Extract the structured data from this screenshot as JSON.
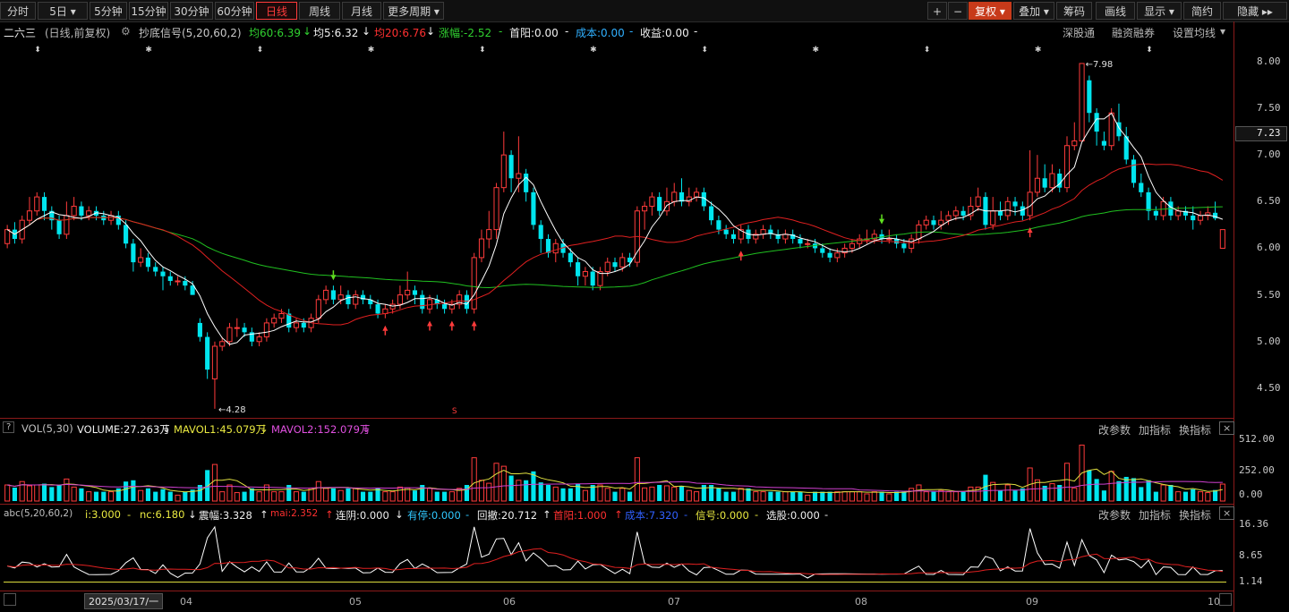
{
  "toolbar": {
    "left": [
      "分时",
      "5日",
      "5分钟",
      "15分钟",
      "30分钟",
      "60分钟",
      "日线",
      "周线",
      "月线",
      "更多周期"
    ],
    "right": [
      "+",
      "−",
      "复权",
      "叠加",
      "筹码",
      "画线",
      "显示",
      "简约",
      "隐藏"
    ],
    "dropdown_glyph": "▾",
    "hide_glyph": "▸▸"
  },
  "info": {
    "name": "二六三",
    "mode": "(日线,前复权)",
    "indicator": "抄底信号(5,20,60,2)",
    "ma60": "均60:6.39",
    "ma60_arrow": "↓",
    "ma5": "均5:6.32",
    "ma5_arrow": "↓",
    "ma20": "均20:6.76",
    "ma20_arrow": "↓",
    "zhangfu": "涨幅:-2.52",
    "shouyang": "首阳:0.00",
    "dash": "-",
    "chengben": "成本:0.00",
    "shouyi": "收益:0.00",
    "links": [
      "深股通",
      "融资融券",
      "设置均线"
    ]
  },
  "price_axis": [
    "8.00",
    "7.50",
    "7.23",
    "7.00",
    "6.50",
    "6.00",
    "5.50",
    "5.00",
    "4.50"
  ],
  "price_axis_current": "7.23",
  "annotations": {
    "high": "←7.98",
    "low": "←4.28",
    "s_mark": "S"
  },
  "vol": {
    "help": "?",
    "label": "VOL(5,30)",
    "volume": "VOLUME:27.263万",
    "volume_arrow": "↓",
    "mavol1": "MAVOL1:45.079万",
    "mavol1_arrow": "↓",
    "mavol2": "MAVOL2:152.079万",
    "mavol2_arrow": "↓",
    "buttons": [
      "改参数",
      "加指标",
      "换指标"
    ],
    "close": "×",
    "axis": [
      "512.00",
      "252.00",
      "0.00"
    ]
  },
  "abc": {
    "label": "abc(5,20,60,2)",
    "i": "i:3.000",
    "nc": "nc:6.180",
    "nc_arrow": "↓",
    "zhenfu": "震幅:3.328",
    "zhenfu_arrow": "↑",
    "mai": "mai:2.352",
    "mai_arrow": "↑",
    "lianyin": "连阴:0.000",
    "lianyin_arrow": "↓",
    "youting": "有停:0.000",
    "huiche": "回撤:20.712",
    "huiche_arrow": "↑",
    "shouyang": "首阳:1.000",
    "shouyang_arrow": "↑",
    "chengben": "成本:7.320",
    "xinhao": "信号:0.000",
    "xuangu": "选股:0.000",
    "dash": "-",
    "buttons": [
      "改参数",
      "加指标",
      "换指标"
    ],
    "close": "×",
    "axis": [
      "16.36",
      "8.65",
      "1.14"
    ]
  },
  "xaxis": {
    "date": "2025/03/17/一",
    "months": [
      "04",
      "05",
      "06",
      "07",
      "08",
      "09",
      "10"
    ]
  },
  "colors": {
    "up": "#ff3b3b",
    "down": "#00e5ee",
    "ma5": "#ffffff",
    "ma20": "#e02020",
    "ma60": "#20c020",
    "mavol1": "#e0e040",
    "mavol2": "#d040d0"
  },
  "chart_data": {
    "type": "candlestick",
    "price_range": [
      4.25,
      8.2
    ],
    "candles": [
      {
        "o": 6.05,
        "c": 6.2,
        "h": 6.25,
        "l": 6.0
      },
      {
        "o": 6.2,
        "c": 6.1,
        "h": 6.28,
        "l": 6.05
      },
      {
        "o": 6.1,
        "c": 6.3,
        "h": 6.35,
        "l": 6.05
      },
      {
        "o": 6.3,
        "c": 6.4,
        "h": 6.55,
        "l": 6.25
      },
      {
        "o": 6.4,
        "c": 6.55,
        "h": 6.6,
        "l": 6.35
      },
      {
        "o": 6.55,
        "c": 6.4,
        "h": 6.6,
        "l": 6.3
      },
      {
        "o": 6.4,
        "c": 6.3,
        "h": 6.45,
        "l": 6.2
      },
      {
        "o": 6.3,
        "c": 6.15,
        "h": 6.35,
        "l": 6.1
      },
      {
        "o": 6.15,
        "c": 6.35,
        "h": 6.5,
        "l": 6.1
      },
      {
        "o": 6.35,
        "c": 6.45,
        "h": 6.55,
        "l": 6.3
      },
      {
        "o": 6.45,
        "c": 6.35,
        "h": 6.5,
        "l": 6.3
      },
      {
        "o": 6.35,
        "c": 6.4,
        "h": 6.45,
        "l": 6.3
      },
      {
        "o": 6.4,
        "c": 6.35,
        "h": 6.45,
        "l": 6.3
      },
      {
        "o": 6.35,
        "c": 6.3,
        "h": 6.4,
        "l": 6.25
      },
      {
        "o": 6.3,
        "c": 6.35,
        "h": 6.4,
        "l": 6.25
      },
      {
        "o": 6.35,
        "c": 6.25,
        "h": 6.4,
        "l": 6.2
      },
      {
        "o": 6.25,
        "c": 6.05,
        "h": 6.3,
        "l": 6.0
      },
      {
        "o": 6.05,
        "c": 5.85,
        "h": 6.1,
        "l": 5.75
      },
      {
        "o": 5.85,
        "c": 5.9,
        "h": 6.0,
        "l": 5.8
      },
      {
        "o": 5.9,
        "c": 5.8,
        "h": 5.95,
        "l": 5.75
      },
      {
        "o": 5.8,
        "c": 5.75,
        "h": 5.85,
        "l": 5.7
      },
      {
        "o": 5.75,
        "c": 5.7,
        "h": 5.8,
        "l": 5.55
      },
      {
        "o": 5.7,
        "c": 5.65,
        "h": 5.75,
        "l": 5.6
      },
      {
        "o": 5.65,
        "c": 5.65,
        "h": 5.7,
        "l": 5.6
      },
      {
        "o": 5.65,
        "c": 5.6,
        "h": 5.7,
        "l": 5.55
      },
      {
        "o": 5.6,
        "c": 5.5,
        "h": 5.65,
        "l": 5.5
      },
      {
        "o": 5.2,
        "c": 5.05,
        "h": 5.25,
        "l": 5.0
      },
      {
        "o": 5.05,
        "c": 4.7,
        "h": 5.1,
        "l": 4.6
      },
      {
        "o": 4.6,
        "c": 4.95,
        "h": 5.0,
        "l": 4.28
      },
      {
        "o": 4.95,
        "c": 5.0,
        "h": 5.05,
        "l": 4.9
      },
      {
        "o": 5.0,
        "c": 5.15,
        "h": 5.2,
        "l": 4.95
      },
      {
        "o": 5.15,
        "c": 5.15,
        "h": 5.25,
        "l": 5.05
      },
      {
        "o": 5.15,
        "c": 5.1,
        "h": 5.2,
        "l": 5.05
      },
      {
        "o": 5.1,
        "c": 5.0,
        "h": 5.15,
        "l": 4.95
      },
      {
        "o": 5.0,
        "c": 5.05,
        "h": 5.1,
        "l": 4.95
      },
      {
        "o": 5.05,
        "c": 5.2,
        "h": 5.25,
        "l": 5.0
      },
      {
        "o": 5.2,
        "c": 5.25,
        "h": 5.3,
        "l": 5.15
      },
      {
        "o": 5.25,
        "c": 5.3,
        "h": 5.35,
        "l": 5.2
      },
      {
        "o": 5.3,
        "c": 5.15,
        "h": 5.35,
        "l": 5.1
      },
      {
        "o": 5.15,
        "c": 5.2,
        "h": 5.25,
        "l": 5.1
      },
      {
        "o": 5.2,
        "c": 5.15,
        "h": 5.25,
        "l": 5.1
      },
      {
        "o": 5.15,
        "c": 5.25,
        "h": 5.3,
        "l": 5.1
      },
      {
        "o": 5.25,
        "c": 5.45,
        "h": 5.5,
        "l": 5.2
      },
      {
        "o": 5.45,
        "c": 5.55,
        "h": 5.6,
        "l": 5.4
      },
      {
        "o": 5.55,
        "c": 5.45,
        "h": 5.6,
        "l": 5.4
      },
      {
        "o": 5.45,
        "c": 5.5,
        "h": 5.6,
        "l": 5.4
      },
      {
        "o": 5.5,
        "c": 5.4,
        "h": 5.55,
        "l": 5.35
      },
      {
        "o": 5.4,
        "c": 5.5,
        "h": 5.55,
        "l": 5.35
      },
      {
        "o": 5.5,
        "c": 5.45,
        "h": 5.55,
        "l": 5.4
      },
      {
        "o": 5.45,
        "c": 5.4,
        "h": 5.5,
        "l": 5.35
      },
      {
        "o": 5.4,
        "c": 5.3,
        "h": 5.45,
        "l": 5.25
      },
      {
        "o": 5.3,
        "c": 5.35,
        "h": 5.4,
        "l": 5.25
      },
      {
        "o": 5.35,
        "c": 5.4,
        "h": 5.45,
        "l": 5.3
      },
      {
        "o": 5.4,
        "c": 5.5,
        "h": 5.6,
        "l": 5.35
      },
      {
        "o": 5.5,
        "c": 5.55,
        "h": 5.75,
        "l": 5.45
      },
      {
        "o": 5.55,
        "c": 5.5,
        "h": 5.6,
        "l": 5.4
      },
      {
        "o": 5.5,
        "c": 5.35,
        "h": 5.55,
        "l": 5.3
      },
      {
        "o": 5.35,
        "c": 5.45,
        "h": 5.5,
        "l": 5.3
      },
      {
        "o": 5.45,
        "c": 5.4,
        "h": 5.5,
        "l": 5.35
      },
      {
        "o": 5.4,
        "c": 5.35,
        "h": 5.45,
        "l": 5.3
      },
      {
        "o": 5.35,
        "c": 5.4,
        "h": 5.45,
        "l": 5.3
      },
      {
        "o": 5.4,
        "c": 5.5,
        "h": 5.55,
        "l": 5.35
      },
      {
        "o": 5.5,
        "c": 5.35,
        "h": 5.55,
        "l": 5.3
      },
      {
        "o": 5.35,
        "c": 5.9,
        "h": 5.95,
        "l": 5.3
      },
      {
        "o": 5.9,
        "c": 6.1,
        "h": 6.2,
        "l": 5.85
      },
      {
        "o": 6.1,
        "c": 6.2,
        "h": 6.4,
        "l": 6.0
      },
      {
        "o": 6.2,
        "c": 6.65,
        "h": 6.7,
        "l": 6.1
      },
      {
        "o": 6.65,
        "c": 7.0,
        "h": 7.25,
        "l": 6.6
      },
      {
        "o": 7.0,
        "c": 6.75,
        "h": 7.05,
        "l": 6.6
      },
      {
        "o": 6.75,
        "c": 6.8,
        "h": 7.2,
        "l": 6.6
      },
      {
        "o": 6.8,
        "c": 6.6,
        "h": 6.85,
        "l": 6.5
      },
      {
        "o": 6.6,
        "c": 6.25,
        "h": 6.65,
        "l": 6.2
      },
      {
        "o": 6.25,
        "c": 6.1,
        "h": 6.3,
        "l": 5.95
      },
      {
        "o": 6.1,
        "c": 5.95,
        "h": 6.15,
        "l": 5.9
      },
      {
        "o": 5.95,
        "c": 6.05,
        "h": 6.1,
        "l": 5.85
      },
      {
        "o": 6.05,
        "c": 5.95,
        "h": 6.1,
        "l": 5.9
      },
      {
        "o": 5.95,
        "c": 5.85,
        "h": 6.0,
        "l": 5.8
      },
      {
        "o": 5.85,
        "c": 5.7,
        "h": 5.9,
        "l": 5.6
      },
      {
        "o": 5.7,
        "c": 5.75,
        "h": 5.8,
        "l": 5.6
      },
      {
        "o": 5.75,
        "c": 5.6,
        "h": 5.8,
        "l": 5.55
      },
      {
        "o": 5.6,
        "c": 5.75,
        "h": 5.8,
        "l": 5.55
      },
      {
        "o": 5.75,
        "c": 5.85,
        "h": 5.9,
        "l": 5.7
      },
      {
        "o": 5.85,
        "c": 5.8,
        "h": 5.9,
        "l": 5.75
      },
      {
        "o": 5.8,
        "c": 5.9,
        "h": 5.95,
        "l": 5.75
      },
      {
        "o": 5.9,
        "c": 5.85,
        "h": 5.95,
        "l": 5.8
      },
      {
        "o": 5.85,
        "c": 6.4,
        "h": 6.45,
        "l": 5.8
      },
      {
        "o": 6.4,
        "c": 6.45,
        "h": 6.5,
        "l": 6.2
      },
      {
        "o": 6.45,
        "c": 6.55,
        "h": 6.6,
        "l": 6.35
      },
      {
        "o": 6.55,
        "c": 6.4,
        "h": 6.6,
        "l": 6.35
      },
      {
        "o": 6.4,
        "c": 6.5,
        "h": 6.65,
        "l": 6.35
      },
      {
        "o": 6.5,
        "c": 6.6,
        "h": 6.7,
        "l": 6.45
      },
      {
        "o": 6.6,
        "c": 6.5,
        "h": 6.75,
        "l": 6.45
      },
      {
        "o": 6.5,
        "c": 6.55,
        "h": 6.65,
        "l": 6.45
      },
      {
        "o": 6.55,
        "c": 6.6,
        "h": 6.65,
        "l": 6.5
      },
      {
        "o": 6.6,
        "c": 6.45,
        "h": 6.65,
        "l": 6.4
      },
      {
        "o": 6.45,
        "c": 6.3,
        "h": 6.5,
        "l": 6.25
      },
      {
        "o": 6.3,
        "c": 6.2,
        "h": 6.35,
        "l": 6.15
      },
      {
        "o": 6.2,
        "c": 6.15,
        "h": 6.25,
        "l": 6.1
      },
      {
        "o": 6.15,
        "c": 6.1,
        "h": 6.2,
        "l": 6.05
      },
      {
        "o": 6.1,
        "c": 6.2,
        "h": 6.25,
        "l": 6.05
      },
      {
        "o": 6.2,
        "c": 6.1,
        "h": 6.25,
        "l": 6.05
      },
      {
        "o": 6.1,
        "c": 6.15,
        "h": 6.2,
        "l": 6.05
      },
      {
        "o": 6.15,
        "c": 6.2,
        "h": 6.25,
        "l": 6.1
      },
      {
        "o": 6.2,
        "c": 6.15,
        "h": 6.25,
        "l": 6.1
      },
      {
        "o": 6.15,
        "c": 6.1,
        "h": 6.2,
        "l": 6.05
      },
      {
        "o": 6.1,
        "c": 6.15,
        "h": 6.2,
        "l": 6.05
      },
      {
        "o": 6.15,
        "c": 6.1,
        "h": 6.2,
        "l": 6.05
      },
      {
        "o": 6.1,
        "c": 6.05,
        "h": 6.15,
        "l": 6.0
      },
      {
        "o": 6.05,
        "c": 6.05,
        "h": 6.1,
        "l": 6.0
      },
      {
        "o": 6.05,
        "c": 6.0,
        "h": 6.1,
        "l": 5.95
      },
      {
        "o": 6.0,
        "c": 5.95,
        "h": 6.05,
        "l": 5.9
      },
      {
        "o": 5.95,
        "c": 5.9,
        "h": 6.0,
        "l": 5.85
      },
      {
        "o": 5.9,
        "c": 5.95,
        "h": 6.0,
        "l": 5.85
      },
      {
        "o": 5.95,
        "c": 6.0,
        "h": 6.05,
        "l": 5.9
      },
      {
        "o": 6.0,
        "c": 6.05,
        "h": 6.1,
        "l": 5.95
      },
      {
        "o": 6.05,
        "c": 6.1,
        "h": 6.15,
        "l": 6.0
      },
      {
        "o": 6.1,
        "c": 6.1,
        "h": 6.2,
        "l": 6.05
      },
      {
        "o": 6.1,
        "c": 6.15,
        "h": 6.2,
        "l": 6.05
      },
      {
        "o": 6.15,
        "c": 6.1,
        "h": 6.2,
        "l": 6.05
      },
      {
        "o": 6.1,
        "c": 6.1,
        "h": 6.2,
        "l": 6.05
      },
      {
        "o": 6.1,
        "c": 6.05,
        "h": 6.15,
        "l": 6.0
      },
      {
        "o": 6.05,
        "c": 6.0,
        "h": 6.1,
        "l": 5.95
      },
      {
        "o": 6.0,
        "c": 6.1,
        "h": 6.15,
        "l": 5.95
      },
      {
        "o": 6.1,
        "c": 6.25,
        "h": 6.3,
        "l": 6.05
      },
      {
        "o": 6.25,
        "c": 6.3,
        "h": 6.35,
        "l": 6.2
      },
      {
        "o": 6.3,
        "c": 6.25,
        "h": 6.35,
        "l": 6.2
      },
      {
        "o": 6.25,
        "c": 6.3,
        "h": 6.4,
        "l": 6.2
      },
      {
        "o": 6.3,
        "c": 6.35,
        "h": 6.4,
        "l": 6.25
      },
      {
        "o": 6.35,
        "c": 6.4,
        "h": 6.45,
        "l": 6.3
      },
      {
        "o": 6.4,
        "c": 6.35,
        "h": 6.45,
        "l": 6.3
      },
      {
        "o": 6.35,
        "c": 6.45,
        "h": 6.55,
        "l": 6.3
      },
      {
        "o": 6.45,
        "c": 6.55,
        "h": 6.65,
        "l": 6.4
      },
      {
        "o": 6.55,
        "c": 6.25,
        "h": 6.6,
        "l": 6.2
      },
      {
        "o": 6.25,
        "c": 6.4,
        "h": 6.55,
        "l": 6.2
      },
      {
        "o": 6.4,
        "c": 6.35,
        "h": 6.5,
        "l": 6.3
      },
      {
        "o": 6.35,
        "c": 6.5,
        "h": 6.55,
        "l": 6.3
      },
      {
        "o": 6.5,
        "c": 6.45,
        "h": 6.55,
        "l": 6.35
      },
      {
        "o": 6.45,
        "c": 6.35,
        "h": 6.5,
        "l": 6.3
      },
      {
        "o": 6.35,
        "c": 6.6,
        "h": 7.05,
        "l": 6.3
      },
      {
        "o": 6.6,
        "c": 6.75,
        "h": 7.0,
        "l": 6.55
      },
      {
        "o": 6.75,
        "c": 6.65,
        "h": 6.9,
        "l": 6.6
      },
      {
        "o": 6.65,
        "c": 6.8,
        "h": 6.9,
        "l": 6.6
      },
      {
        "o": 6.8,
        "c": 6.65,
        "h": 6.85,
        "l": 6.6
      },
      {
        "o": 6.65,
        "c": 7.1,
        "h": 7.2,
        "l": 6.6
      },
      {
        "o": 7.1,
        "c": 7.15,
        "h": 7.35,
        "l": 7.05
      },
      {
        "o": 7.15,
        "c": 7.98,
        "h": 7.98,
        "l": 7.3
      },
      {
        "o": 7.8,
        "c": 7.45,
        "h": 7.85,
        "l": 7.35
      },
      {
        "o": 7.45,
        "c": 7.25,
        "h": 7.5,
        "l": 7.1
      },
      {
        "o": 7.15,
        "c": 7.1,
        "h": 7.25,
        "l": 7.05
      },
      {
        "o": 7.1,
        "c": 7.45,
        "h": 7.5,
        "l": 7.05
      },
      {
        "o": 7.35,
        "c": 7.2,
        "h": 7.55,
        "l": 7.15
      },
      {
        "o": 7.2,
        "c": 6.95,
        "h": 7.3,
        "l": 6.9
      },
      {
        "o": 6.95,
        "c": 6.7,
        "h": 7.0,
        "l": 6.65
      },
      {
        "o": 6.7,
        "c": 6.6,
        "h": 6.8,
        "l": 6.55
      },
      {
        "o": 6.6,
        "c": 6.4,
        "h": 6.65,
        "l": 6.3
      },
      {
        "o": 6.4,
        "c": 6.35,
        "h": 6.45,
        "l": 6.3
      },
      {
        "o": 6.35,
        "c": 6.5,
        "h": 6.55,
        "l": 6.3
      },
      {
        "o": 6.5,
        "c": 6.35,
        "h": 6.55,
        "l": 6.3
      },
      {
        "o": 6.35,
        "c": 6.4,
        "h": 6.45,
        "l": 6.3
      },
      {
        "o": 6.4,
        "c": 6.35,
        "h": 6.45,
        "l": 6.3
      },
      {
        "o": 6.35,
        "c": 6.3,
        "h": 6.45,
        "l": 6.2
      },
      {
        "o": 6.3,
        "c": 6.35,
        "h": 6.4,
        "l": 6.25
      },
      {
        "o": 6.35,
        "c": 6.38,
        "h": 6.45,
        "l": 6.3
      },
      {
        "o": 6.38,
        "c": 6.32,
        "h": 6.5,
        "l": 6.3
      },
      {
        "o": 6.0,
        "c": 6.2,
        "h": 6.2,
        "l": 6.0
      }
    ]
  }
}
